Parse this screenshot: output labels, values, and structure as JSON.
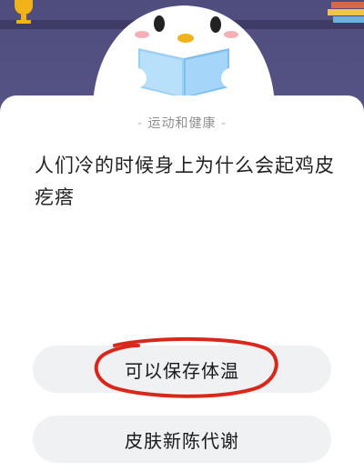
{
  "category": {
    "label": "运动和健康"
  },
  "question": {
    "line1": "人们冷的时候身上为什么会起鸡皮",
    "line2": "疙瘩"
  },
  "options": [
    {
      "label": "可以保存体温"
    },
    {
      "label": "皮肤新陈代谢"
    }
  ],
  "colors": {
    "background_purple": "#5d5a8c",
    "card_white": "#ffffff",
    "option_bg": "#f0f1f3",
    "annotation_red": "#d9281a"
  },
  "icons": {
    "trophy": "trophy-icon",
    "books": "books-icon",
    "mascot": "penguin-mascot-icon"
  }
}
